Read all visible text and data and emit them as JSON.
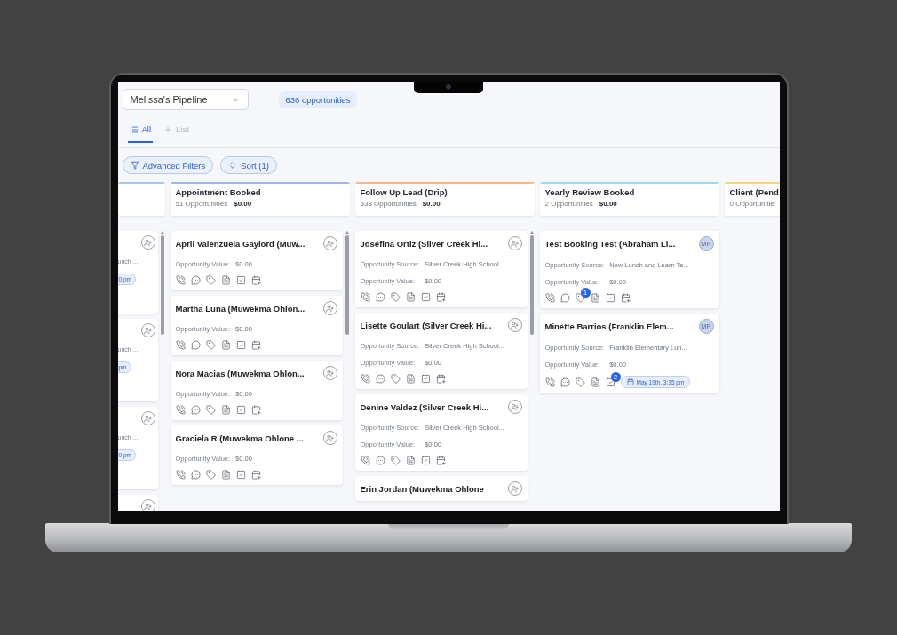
{
  "pipeline_select": {
    "value": "Melissa's Pipeline"
  },
  "opportunity_count": "636 opportunities",
  "tabs": [
    {
      "label": "All",
      "kind": "list",
      "selected": true
    },
    {
      "label": "List",
      "kind": "add",
      "selected": false
    }
  ],
  "filter_buttons": [
    {
      "label": "Advanced Filters",
      "kind": "filter"
    },
    {
      "label": "Sort (1)",
      "kind": "sort"
    }
  ],
  "stages": [
    {
      "kind": "partial",
      "color": "#a9c2ef",
      "scrollbar": true,
      "cards": [
        {
          "avatar": {
            "kind": "assign"
          },
          "fragment": "unch ...",
          "pill": "0 pm"
        },
        {
          "avatar": {
            "kind": "assign"
          },
          "fragment": "unch ...",
          "pill": "pm"
        },
        {
          "avatar": {
            "kind": "assign"
          },
          "fragment": "unch ...",
          "pill": "0 pm"
        },
        {
          "avatar": {
            "kind": "assign"
          }
        }
      ]
    },
    {
      "kind": "full",
      "title": "Appointment Booked",
      "count": "51 Opportunities",
      "amount": "$0.00",
      "color": "#9db7ee",
      "scrollbar": true,
      "cards": [
        {
          "name": "April Valenzuela Gaylord (Muw...",
          "avatar": {
            "kind": "assign"
          },
          "fields": [
            {
              "label": "Opportunity Value:",
              "value": "$0.00"
            }
          ],
          "actions": [
            {
              "kind": "call"
            },
            {
              "kind": "message"
            },
            {
              "kind": "tag"
            },
            {
              "kind": "note"
            },
            {
              "kind": "task"
            },
            {
              "kind": "appointment"
            }
          ]
        },
        {
          "name": "Martha Luna (Muwekma Ohlon...",
          "avatar": {
            "kind": "assign"
          },
          "fields": [
            {
              "label": "Opportunity Value:",
              "value": "$0.00"
            }
          ],
          "actions": [
            {
              "kind": "call"
            },
            {
              "kind": "message"
            },
            {
              "kind": "tag"
            },
            {
              "kind": "note"
            },
            {
              "kind": "task"
            },
            {
              "kind": "appointment"
            }
          ]
        },
        {
          "name": "Nora Macias (Muwekma Ohlon...",
          "avatar": {
            "kind": "assign"
          },
          "fields": [
            {
              "label": "Opportunity Value:",
              "value": "$0.00"
            }
          ],
          "actions": [
            {
              "kind": "call"
            },
            {
              "kind": "message"
            },
            {
              "kind": "tag"
            },
            {
              "kind": "note"
            },
            {
              "kind": "task"
            },
            {
              "kind": "appointment"
            }
          ]
        },
        {
          "name": "Graciela R (Muwekma Ohlone ...",
          "avatar": {
            "kind": "assign"
          },
          "fields": [
            {
              "label": "Opportunity Value:",
              "value": "$0.00"
            }
          ],
          "actions": [
            {
              "kind": "call"
            },
            {
              "kind": "message"
            },
            {
              "kind": "tag"
            },
            {
              "kind": "note"
            },
            {
              "kind": "task"
            },
            {
              "kind": "appointment"
            }
          ]
        }
      ]
    },
    {
      "kind": "full",
      "title": "Follow Up Lead (Drip)",
      "count": "538 Opportunities",
      "amount": "$0.00",
      "color": "#f5b98a",
      "scrollbar": true,
      "cards": [
        {
          "name": "Josefina Ortiz (Silver Creek Hi...",
          "avatar": {
            "kind": "assign"
          },
          "fields": [
            {
              "label": "Opportunity Source:",
              "value": "Silver Creek High School..."
            },
            {
              "label": "Opportunity Value:",
              "value": "$0.00"
            }
          ],
          "actions": [
            {
              "kind": "call"
            },
            {
              "kind": "message"
            },
            {
              "kind": "tag"
            },
            {
              "kind": "note"
            },
            {
              "kind": "task"
            },
            {
              "kind": "appointment"
            }
          ]
        },
        {
          "name": "Lisette Goulart (Silver Creek Hi...",
          "avatar": {
            "kind": "assign"
          },
          "fields": [
            {
              "label": "Opportunity Source:",
              "value": "Silver Creek High School..."
            },
            {
              "label": "Opportunity Value:",
              "value": "$0.00"
            }
          ],
          "actions": [
            {
              "kind": "call"
            },
            {
              "kind": "message"
            },
            {
              "kind": "tag"
            },
            {
              "kind": "note"
            },
            {
              "kind": "task"
            },
            {
              "kind": "appointment"
            }
          ]
        },
        {
          "name": "Denine Valdez (Silver Creek Hi...",
          "avatar": {
            "kind": "assign"
          },
          "fields": [
            {
              "label": "Opportunity Source:",
              "value": "Silver Creek High School..."
            },
            {
              "label": "Opportunity Value:",
              "value": "$0.00"
            }
          ],
          "actions": [
            {
              "kind": "call"
            },
            {
              "kind": "message"
            },
            {
              "kind": "tag"
            },
            {
              "kind": "note"
            },
            {
              "kind": "task"
            },
            {
              "kind": "appointment"
            }
          ]
        },
        {
          "name": "Erin Jordan (Muwekma Ohlone",
          "avatar": {
            "kind": "assign"
          }
        }
      ]
    },
    {
      "kind": "full",
      "title": "Yearly Review Booked",
      "count": "2 Opportunities",
      "amount": "$0.00",
      "color": "#9fd8f2",
      "scrollbar": false,
      "cards": [
        {
          "name": "Test Booking Test (Abraham Li...",
          "avatar": {
            "kind": "initials",
            "text": "MR"
          },
          "fields": [
            {
              "label": "Opportunity Source:",
              "value": "New Lunch and Learn Te..."
            },
            {
              "label": "Opportunity Value:",
              "value": "$0.00"
            }
          ],
          "actions": [
            {
              "kind": "call"
            },
            {
              "kind": "message"
            },
            {
              "kind": "tag",
              "badge": "1"
            },
            {
              "kind": "note"
            },
            {
              "kind": "task"
            },
            {
              "kind": "appointment"
            }
          ]
        },
        {
          "name": "Minette Barrios (Franklin Elem...",
          "avatar": {
            "kind": "initials",
            "text": "MR"
          },
          "fields": [
            {
              "label": "Opportunity Source:",
              "value": "Franklin Elementary Lun..."
            },
            {
              "label": "Opportunity Value:",
              "value": "$0.00"
            }
          ],
          "actions": [
            {
              "kind": "call"
            },
            {
              "kind": "message"
            },
            {
              "kind": "tag"
            },
            {
              "kind": "note"
            },
            {
              "kind": "task",
              "badge": "2"
            }
          ],
          "appointment_pill": "May 19th, 3:15 pm"
        }
      ]
    },
    {
      "kind": "cut",
      "title": "Client (Pend",
      "count": "0 Opportunitie",
      "color": "#f3d77a",
      "scrollbar": false
    }
  ]
}
